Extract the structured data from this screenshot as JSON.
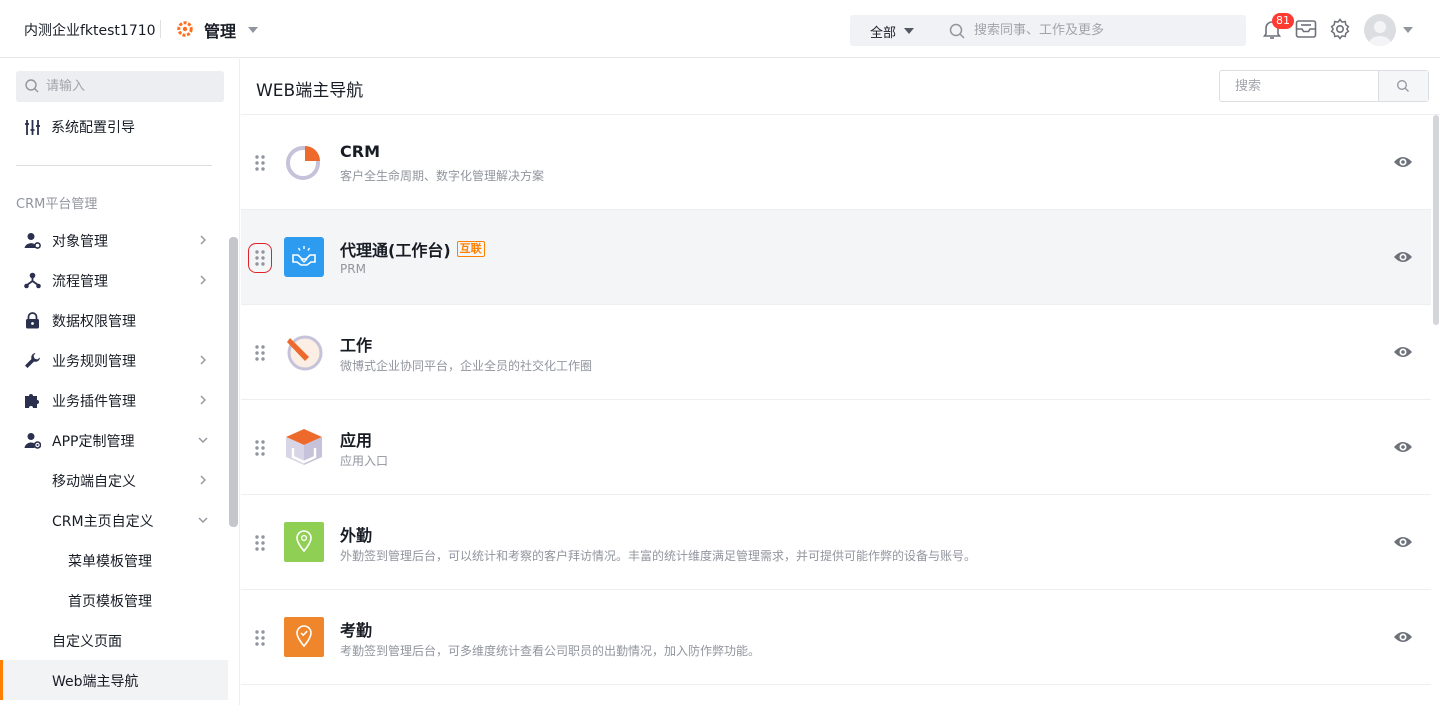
{
  "header": {
    "company": "内测企业fktest1710",
    "section": "管理",
    "search_scope": "全部",
    "search_placeholder": "搜索同事、工作及更多",
    "notification_count": "81"
  },
  "sidebar": {
    "search_placeholder": "请输入",
    "system_guide": "系统配置引导",
    "section_title": "CRM平台管理",
    "items": [
      {
        "label": "对象管理",
        "icon": "user-settings-icon"
      },
      {
        "label": "流程管理",
        "icon": "flow-icon"
      },
      {
        "label": "数据权限管理",
        "icon": "lock-icon"
      },
      {
        "label": "业务规则管理",
        "icon": "wrench-icon"
      },
      {
        "label": "业务插件管理",
        "icon": "puzzle-icon"
      },
      {
        "label": "APP定制管理",
        "icon": "app-custom-icon"
      },
      {
        "label": "移动端自定义"
      },
      {
        "label": "CRM主页自定义"
      },
      {
        "label": "菜单模板管理"
      },
      {
        "label": "首页模板管理"
      },
      {
        "label": "自定义页面"
      },
      {
        "label": "Web端主导航"
      }
    ]
  },
  "main": {
    "title": "WEB端主导航",
    "search_placeholder": "搜索",
    "rows": [
      {
        "title": "CRM",
        "subtitle": "客户全生命周期、数字化管理解决方案",
        "icon": "crm-pie-icon"
      },
      {
        "title": "代理通(工作台)",
        "tag": "互联",
        "subtitle": "PRM",
        "icon": "prm-handshake-icon"
      },
      {
        "title": "工作",
        "subtitle": "微博式企业协同平台，企业全员的社交化工作圈",
        "icon": "work-pen-icon"
      },
      {
        "title": "应用",
        "subtitle": "应用入口",
        "icon": "apps-box-icon"
      },
      {
        "title": "外勤",
        "subtitle": "外勤签到管理后台，可以统计和考察的客户拜访情况。丰富的统计维度满足管理需求，并可提供可能作弊的设备与账号。",
        "icon": "field-location-icon"
      },
      {
        "title": "考勤",
        "subtitle": "考勤签到管理后台，可多维度统计查看公司职员的出勤情况，加入防作弊功能。",
        "icon": "attendance-check-icon"
      }
    ]
  },
  "colors": {
    "accent": "#ff8000",
    "badge": "#ff3a30",
    "crm": "#ee6a2c",
    "prm": "#2d9bf0",
    "field": "#8fcf54",
    "attendance": "#f0862c"
  }
}
